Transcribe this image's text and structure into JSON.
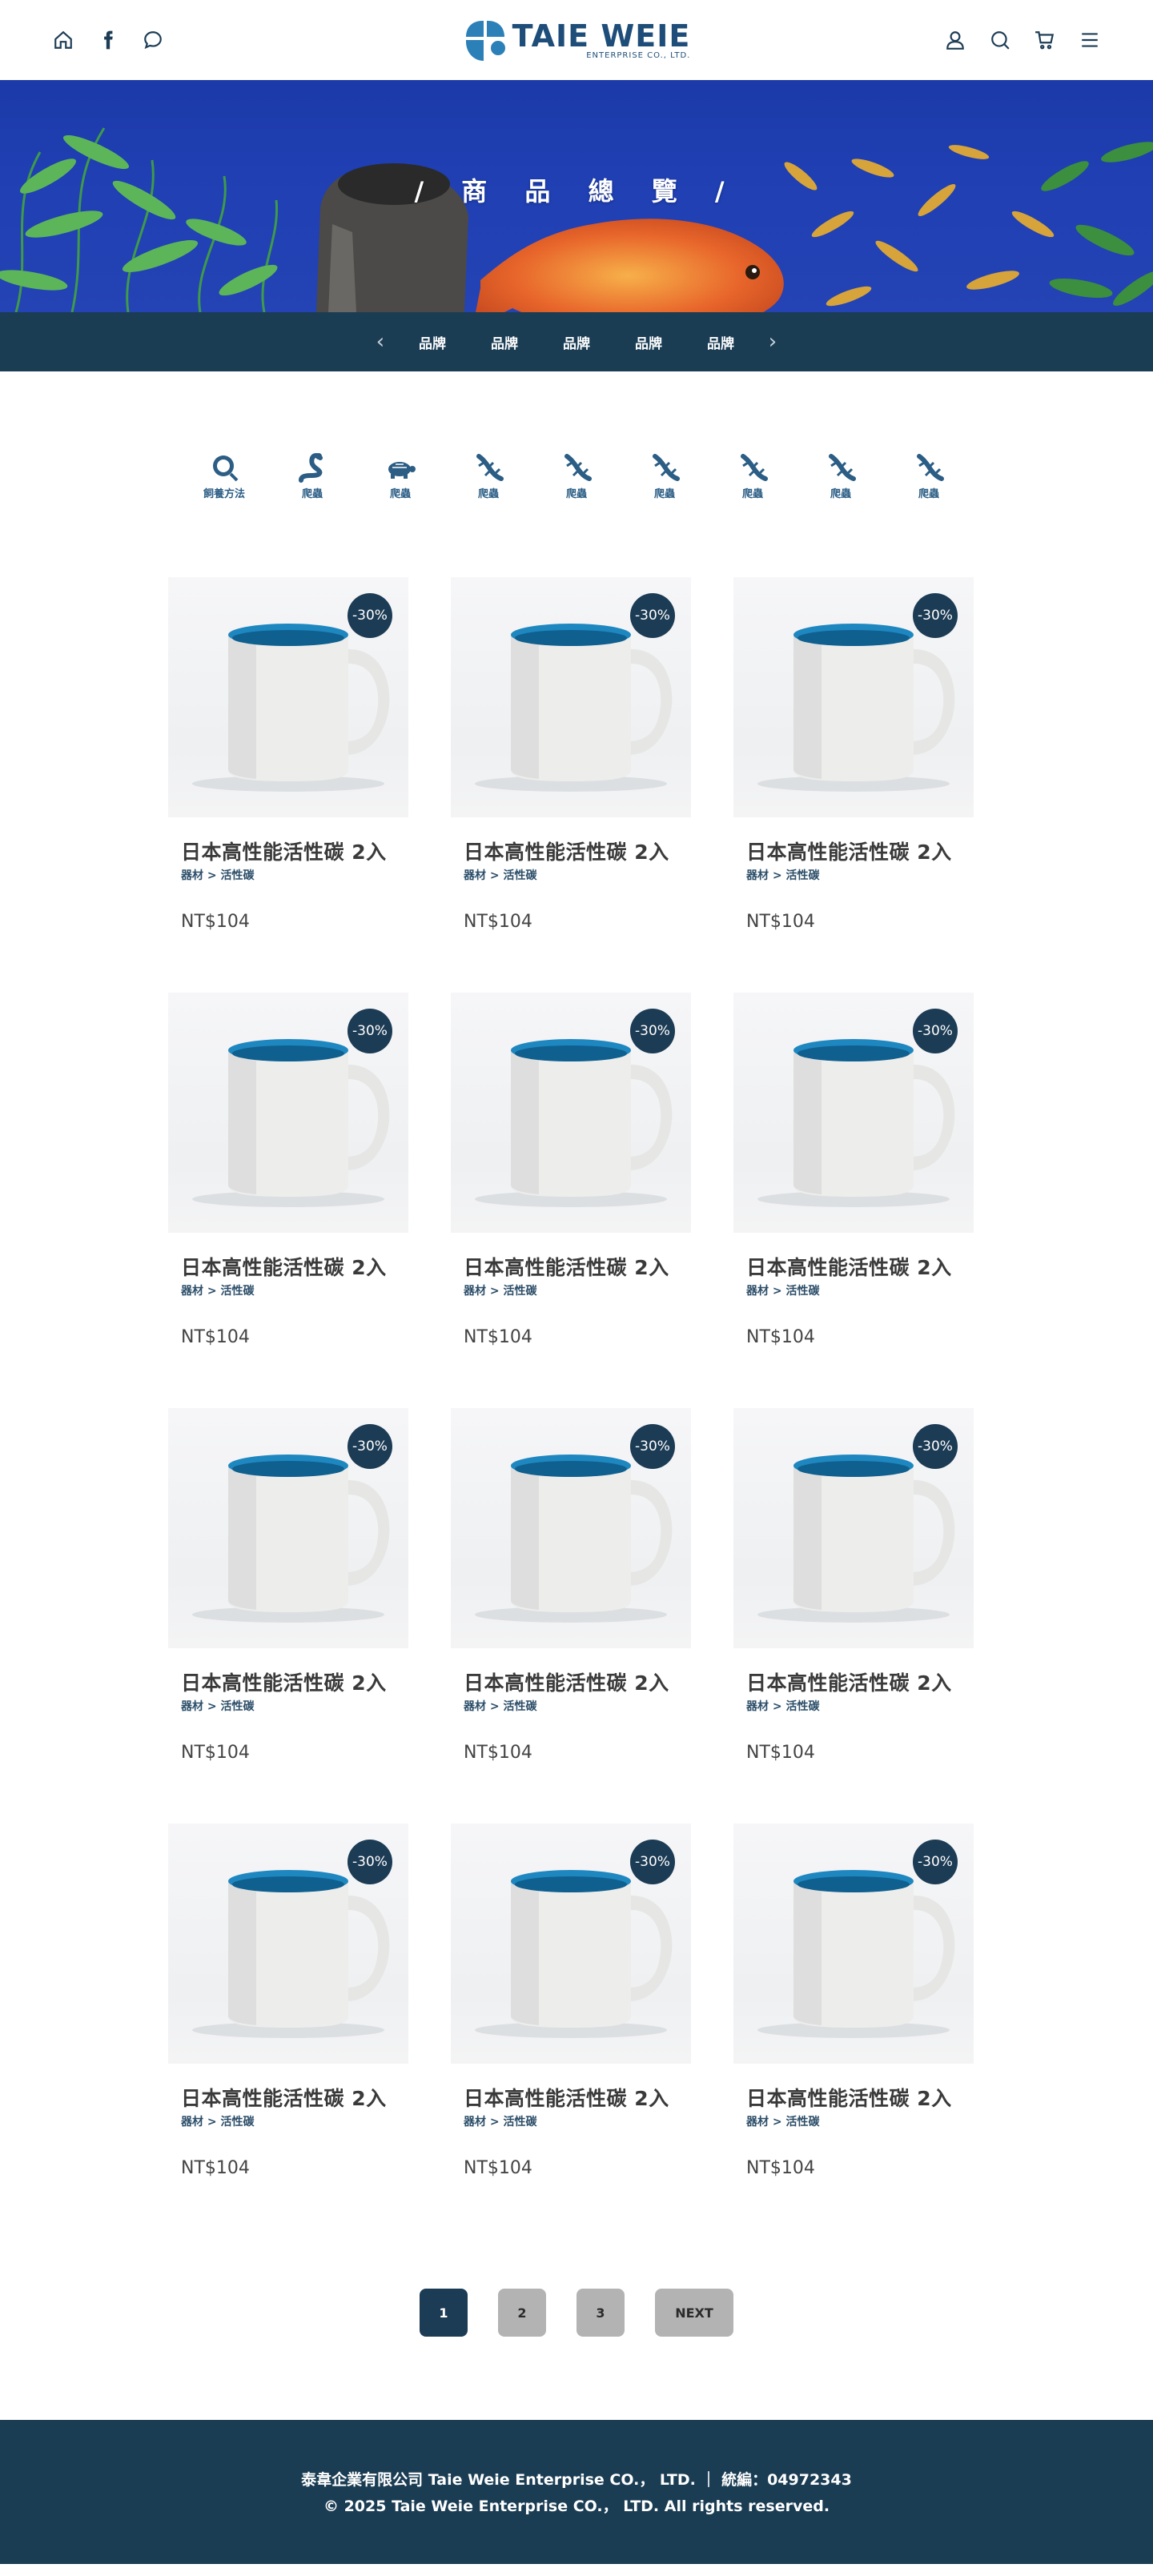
{
  "header": {
    "logo_name": "TAIE WEIE",
    "logo_sub": "ENTERPRISE CO., LTD."
  },
  "hero": {
    "title": "/ 商 品 總 覽 /"
  },
  "brand_bar": {
    "prev": "‹",
    "next": "›",
    "items": [
      "品牌",
      "品牌",
      "品牌",
      "品牌",
      "品牌"
    ]
  },
  "categories": [
    {
      "label": "飼養方法",
      "icon": "magnifier-icon"
    },
    {
      "label": "爬蟲",
      "icon": "snake-icon"
    },
    {
      "label": "爬蟲",
      "icon": "turtle-icon"
    },
    {
      "label": "爬蟲",
      "icon": "lizard-icon"
    },
    {
      "label": "爬蟲",
      "icon": "lizard-icon"
    },
    {
      "label": "爬蟲",
      "icon": "lizard-icon"
    },
    {
      "label": "爬蟲",
      "icon": "lizard-icon"
    },
    {
      "label": "爬蟲",
      "icon": "lizard-icon"
    },
    {
      "label": "爬蟲",
      "icon": "lizard-icon"
    }
  ],
  "products": [
    {
      "title": "日本高性能活性碳 2入",
      "category": "器材 > 活性碳",
      "price": "NT$104",
      "badge": "-30%"
    },
    {
      "title": "日本高性能活性碳 2入",
      "category": "器材 > 活性碳",
      "price": "NT$104",
      "badge": "-30%"
    },
    {
      "title": "日本高性能活性碳 2入",
      "category": "器材 > 活性碳",
      "price": "NT$104",
      "badge": "-30%"
    },
    {
      "title": "日本高性能活性碳 2入",
      "category": "器材 > 活性碳",
      "price": "NT$104",
      "badge": "-30%"
    },
    {
      "title": "日本高性能活性碳 2入",
      "category": "器材 > 活性碳",
      "price": "NT$104",
      "badge": "-30%"
    },
    {
      "title": "日本高性能活性碳 2入",
      "category": "器材 > 活性碳",
      "price": "NT$104",
      "badge": "-30%"
    },
    {
      "title": "日本高性能活性碳 2入",
      "category": "器材 > 活性碳",
      "price": "NT$104",
      "badge": "-30%"
    },
    {
      "title": "日本高性能活性碳 2入",
      "category": "器材 > 活性碳",
      "price": "NT$104",
      "badge": "-30%"
    },
    {
      "title": "日本高性能活性碳 2入",
      "category": "器材 > 活性碳",
      "price": "NT$104",
      "badge": "-30%"
    },
    {
      "title": "日本高性能活性碳 2入",
      "category": "器材 > 活性碳",
      "price": "NT$104",
      "badge": "-30%"
    },
    {
      "title": "日本高性能活性碳 2入",
      "category": "器材 > 活性碳",
      "price": "NT$104",
      "badge": "-30%"
    },
    {
      "title": "日本高性能活性碳 2入",
      "category": "器材 > 活性碳",
      "price": "NT$104",
      "badge": "-30%"
    }
  ],
  "pagination": {
    "pages": [
      "1",
      "2",
      "3"
    ],
    "current": "1",
    "next_label": "NEXT"
  },
  "footer": {
    "line1": "泰韋企業有限公司 Taie Weie Enterprise CO.， LTD.  ｜ 統編：04972343",
    "line2": "© 2025 Taie Weie Enterprise CO.， LTD. All rights reserved."
  },
  "colors": {
    "primary": "#1b3d54",
    "accent": "#2b5d85",
    "pager_inactive": "#b3b3b3"
  }
}
